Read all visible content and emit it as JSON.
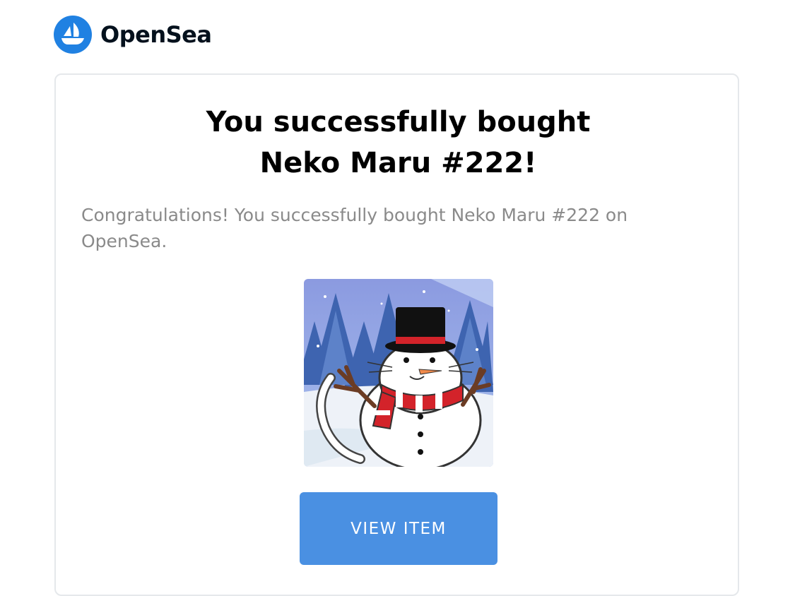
{
  "header": {
    "brand_name": "OpenSea",
    "logo_icon": "opensea-ship-icon",
    "brand_color": "#2081E2"
  },
  "card": {
    "title": "You successfully bought Neko Maru #222!",
    "message": "Congratulations! You successfully bought Neko Maru #222 on OpenSea.",
    "image_icon": "neko-maru-snowman-nft-image",
    "button_label": "VIEW ITEM",
    "button_color": "#4A90E2"
  }
}
